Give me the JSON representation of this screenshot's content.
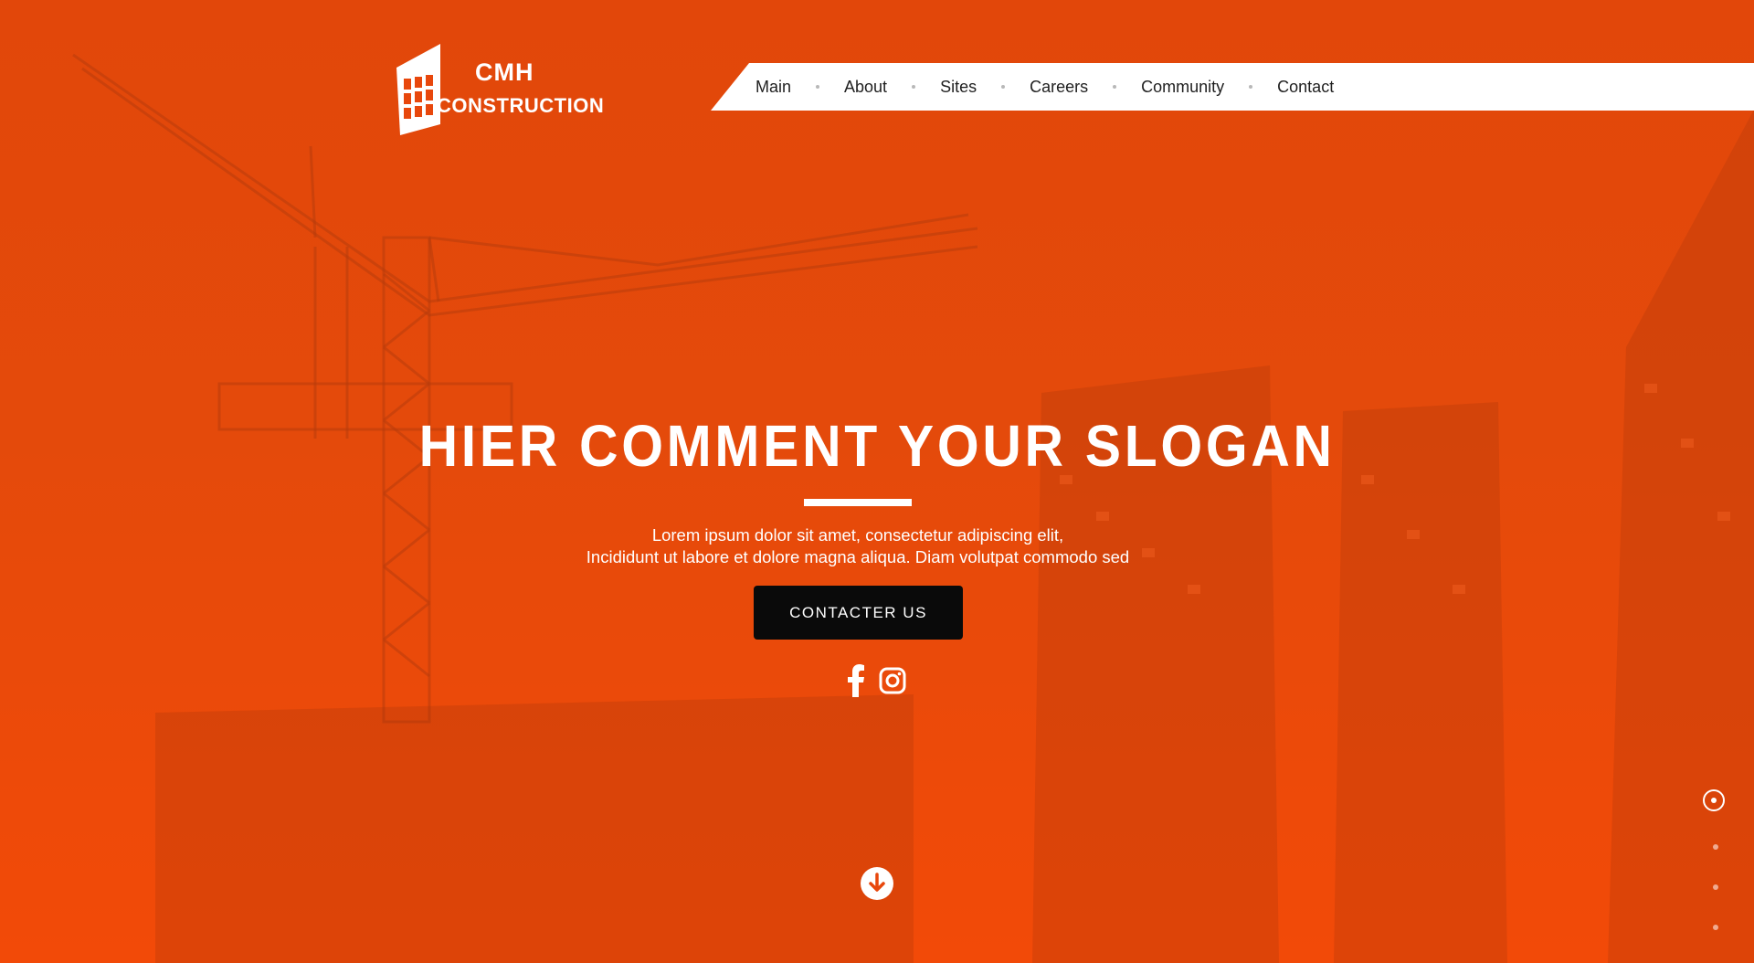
{
  "brand": {
    "name_line1": "CMH",
    "name_line2": "CONSTRUCTION"
  },
  "nav": {
    "items": [
      "Main",
      "About",
      "Sites",
      "Careers",
      "Community",
      "Contact"
    ]
  },
  "hero": {
    "slogan": "HIER COMMENT YOUR SLOGAN",
    "lead_line1": "Lorem ipsum dolor sit amet, consectetur adipiscing elit,",
    "lead_line2": "Incididunt ut labore et dolore magna aliqua. Diam volutpat commodo sed",
    "cta_label": "CONTACTER US"
  },
  "social": {
    "icons": [
      "facebook-icon",
      "instagram-icon"
    ]
  },
  "pager": {
    "slides": 4,
    "active_index": 0
  },
  "colors": {
    "accent": "#e8470c",
    "cta_bg": "#0a0a0a",
    "nav_bg": "#ffffff",
    "text_light": "#ffffff"
  }
}
